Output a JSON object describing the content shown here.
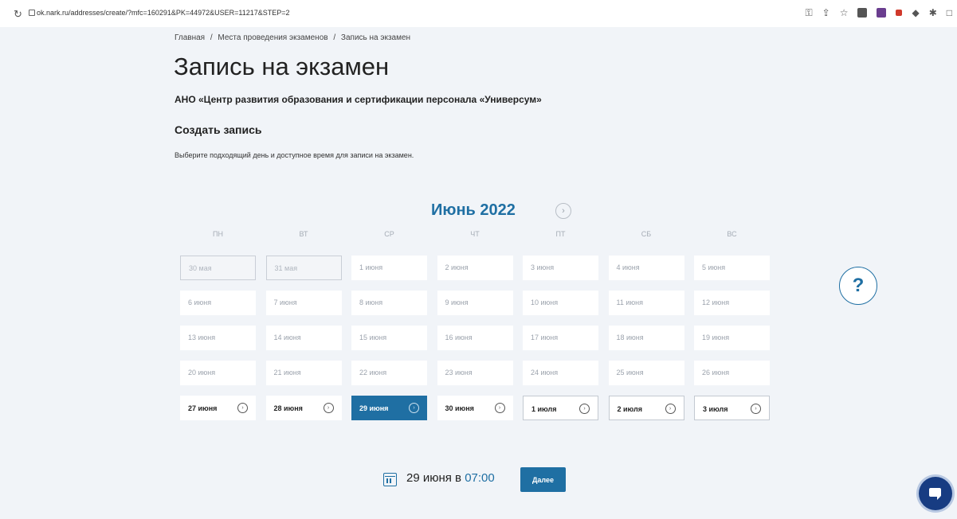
{
  "browser": {
    "url": "ok.nark.ru/addresses/create/?mfc=160291&PK=44972&USER=11217&STEP=2",
    "reload_icon": "reload-icon",
    "icons": [
      "key-icon",
      "share-icon",
      "star-icon",
      "extension-icon",
      "extension-icon",
      "extension-icon",
      "extension-icon",
      "puzzle-icon",
      "sidebar-icon"
    ]
  },
  "breadcrumb": {
    "items": [
      "Главная",
      "/",
      "Места проведения экзаменов",
      "/",
      "Запись на экзамен"
    ]
  },
  "page": {
    "title": "Запись на экзамен",
    "organization": "АНО «Центр развития образования и сертификации персонала «Универсум»",
    "subtitle": "Создать запись",
    "hint": "Выберите подходящий день и доступное время для записи на экзамен."
  },
  "calendar": {
    "month": "Июнь 2022",
    "next_icon": "chevron-right-icon",
    "weekdays": [
      "ПН",
      "ВТ",
      "СР",
      "ЧТ",
      "ПТ",
      "СБ",
      "ВС"
    ],
    "weeks": [
      [
        {
          "label": "30 мая",
          "state": "disabled"
        },
        {
          "label": "31 мая",
          "state": "disabled"
        },
        {
          "label": "1 июня",
          "state": "plain"
        },
        {
          "label": "2 июня",
          "state": "plain"
        },
        {
          "label": "3 июня",
          "state": "plain"
        },
        {
          "label": "4 июня",
          "state": "plain"
        },
        {
          "label": "5 июня",
          "state": "plain"
        }
      ],
      [
        {
          "label": "6 июня",
          "state": "plain"
        },
        {
          "label": "7 июня",
          "state": "plain"
        },
        {
          "label": "8 июня",
          "state": "plain"
        },
        {
          "label": "9 июня",
          "state": "plain"
        },
        {
          "label": "10 июня",
          "state": "plain"
        },
        {
          "label": "11 июня",
          "state": "plain"
        },
        {
          "label": "12 июня",
          "state": "plain"
        }
      ],
      [
        {
          "label": "13 июня",
          "state": "plain"
        },
        {
          "label": "14 июня",
          "state": "plain"
        },
        {
          "label": "15 июня",
          "state": "plain"
        },
        {
          "label": "16 июня",
          "state": "plain"
        },
        {
          "label": "17 июня",
          "state": "plain"
        },
        {
          "label": "18 июня",
          "state": "plain"
        },
        {
          "label": "19 июня",
          "state": "plain"
        }
      ],
      [
        {
          "label": "20 июня",
          "state": "plain"
        },
        {
          "label": "21 июня",
          "state": "plain"
        },
        {
          "label": "22 июня",
          "state": "plain"
        },
        {
          "label": "23 июня",
          "state": "plain"
        },
        {
          "label": "24 июня",
          "state": "plain"
        },
        {
          "label": "25 июня",
          "state": "plain"
        },
        {
          "label": "26 июня",
          "state": "plain"
        }
      ],
      [
        {
          "label": "27 июня",
          "state": "available"
        },
        {
          "label": "28 июня",
          "state": "available"
        },
        {
          "label": "29 июня",
          "state": "selected"
        },
        {
          "label": "30 июня",
          "state": "available"
        },
        {
          "label": "1 июля",
          "state": "available-next"
        },
        {
          "label": "2 июля",
          "state": "available-next"
        },
        {
          "label": "3 июля",
          "state": "available-next"
        }
      ]
    ]
  },
  "help": {
    "label": "?"
  },
  "summary": {
    "date_text": "29 июня в ",
    "time": "07:00",
    "icon": "calendar-icon",
    "next_label": "Далее"
  },
  "chat": {
    "icon": "chat-icon"
  },
  "colors": {
    "accent": "#1f6fa3",
    "background": "#f1f4f8",
    "chat": "#173c82"
  }
}
